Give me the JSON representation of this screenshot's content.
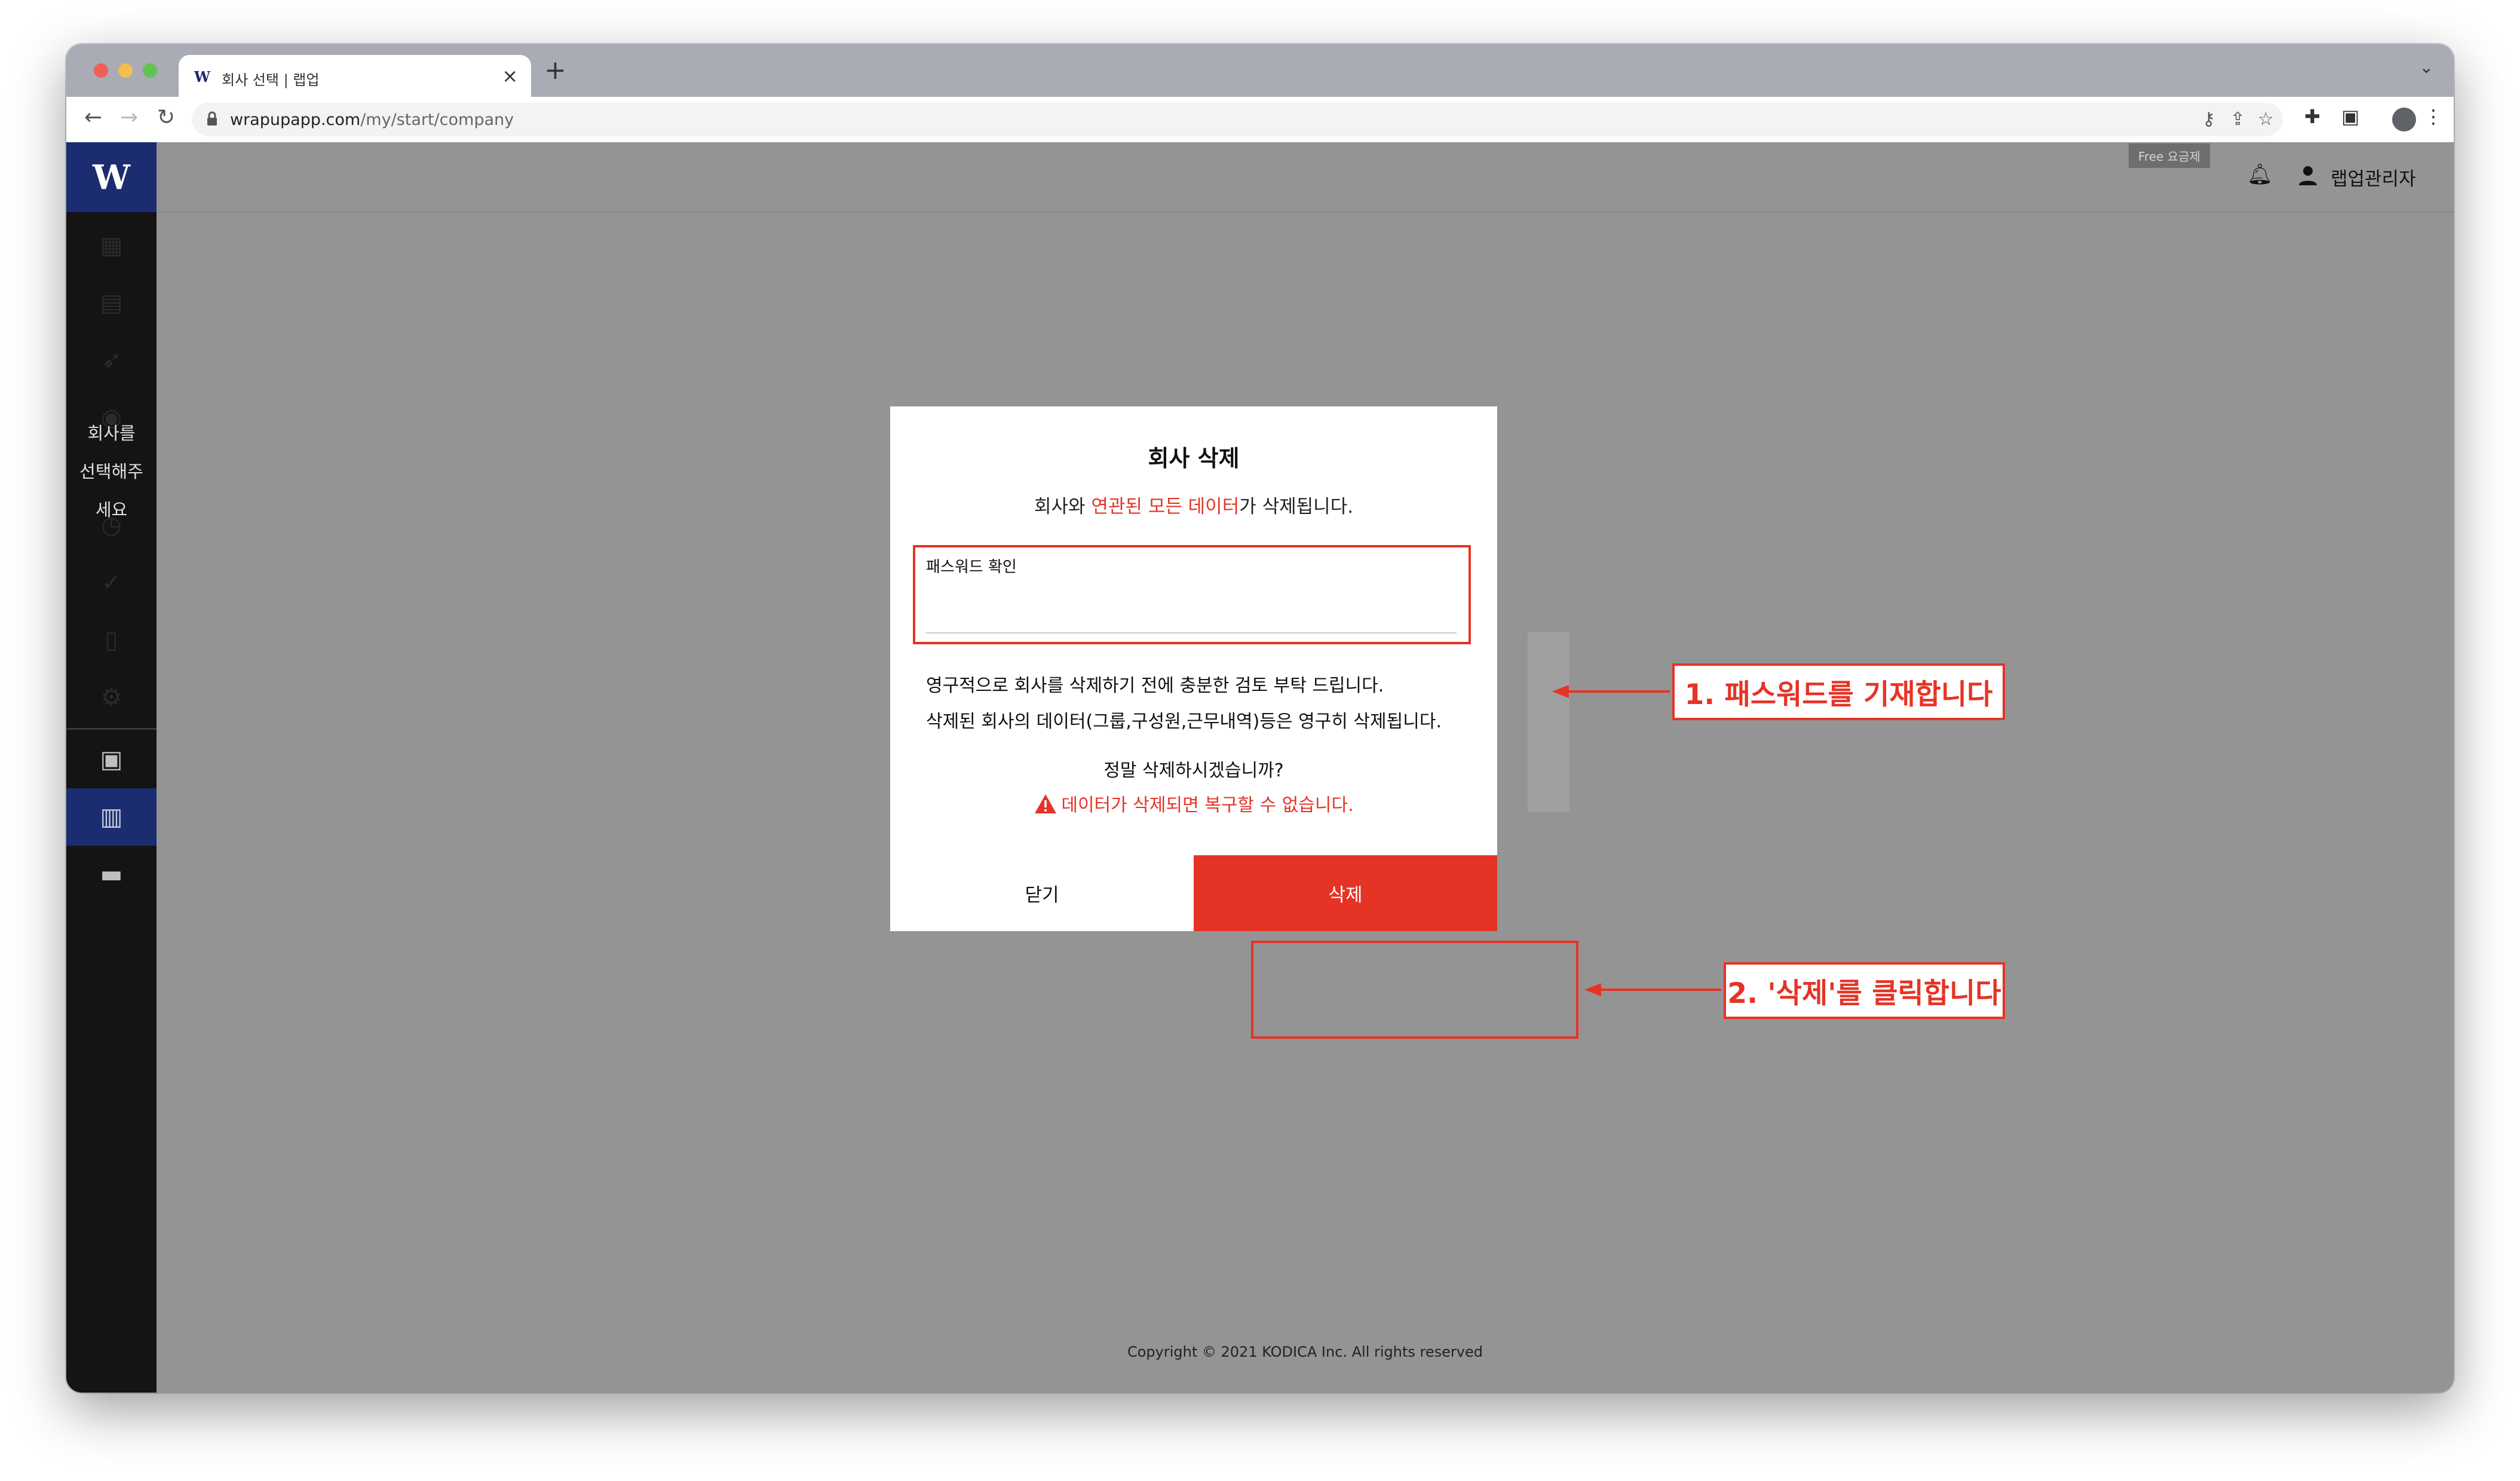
{
  "browser": {
    "tab_title": "회사 선택 | 랩업",
    "favicon": "W",
    "new_tab": "+",
    "url_host": "wrapupapp.com",
    "url_path": "/my/start/company"
  },
  "sidebar": {
    "logo": "W",
    "message": "회사를\n선택해주\n세요",
    "icons": [
      "dashboard-icon",
      "id-card-icon",
      "rocket-icon",
      "globe-icon",
      "clock-icon",
      "check-icon",
      "mobile-icon",
      "gear-icon",
      "account-box-icon",
      "building-icon",
      "store-icon"
    ]
  },
  "header": {
    "plan_badge": "Free 요금제",
    "user_name": "랩업관리자"
  },
  "page": {
    "title": "회사 선택",
    "footer": "Copyright © 2021 KODICA Inc. All rights reserved"
  },
  "modal": {
    "title": "회사 삭제",
    "subtitle_prefix": "회사와 ",
    "subtitle_highlight": "연관된 모든 데이터",
    "subtitle_suffix": "가 삭제됩니다.",
    "password_label": "패스워드 확인",
    "password_value": "",
    "notice_line1": "영구적으로 회사를 삭제하기 전에 충분한 검토 부탁 드립니다.",
    "notice_line2": "삭제된 회사의 데이터(그룹,구성원,근무내역)등은 영구히 삭제됩니다.",
    "confirm_question": "정말 삭제하시겠습니까?",
    "warning": "데이터가 삭제되면 복구할 수 없습니다.",
    "close_button": "닫기",
    "delete_button": "삭제"
  },
  "annotations": {
    "step1": "1. 패스워드를 기재합니다",
    "step2": "2. '삭제'를 클릭합니다"
  },
  "colors": {
    "accent_red": "#e53426",
    "brand_navy": "#1b2d70",
    "overlay_gray": "#949494",
    "sidebar_black": "#141414"
  }
}
